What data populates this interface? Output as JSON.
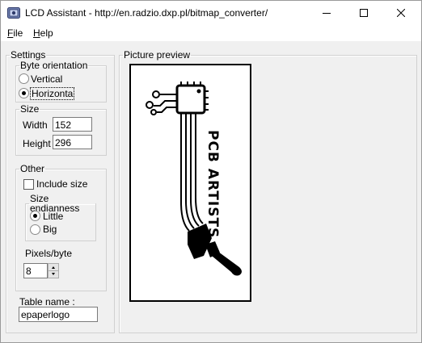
{
  "window": {
    "title": "LCD Assistant -  http://en.radzio.dxp.pl/bitmap_converter/",
    "icon": "lcd-assistant-app-icon",
    "controls": [
      "minimize-icon",
      "maximize-icon",
      "close-icon"
    ]
  },
  "menu": {
    "file_first": "F",
    "file_rest": "ile",
    "help_first": "H",
    "help_rest": "elp"
  },
  "settings": {
    "group_label": "Settings",
    "byte_orientation": {
      "label": "Byte orientation",
      "options": [
        "Vertical",
        "Horizonta"
      ],
      "selected": "Horizonta"
    },
    "size": {
      "label": "Size",
      "width_label": "Width",
      "width_value": "152",
      "height_label": "Height",
      "height_value": "296"
    },
    "other": {
      "label": "Other",
      "include_size_label": "Include size",
      "include_size_checked": false,
      "endianness": {
        "label": "Size endianness",
        "options": [
          "Little",
          "Big"
        ],
        "selected": "Little"
      },
      "pixels_per_byte_label": "Pixels/byte",
      "pixels_per_byte_value": "8"
    },
    "table_name_label": "Table name :",
    "table_name_value": "epaperlogo"
  },
  "preview": {
    "group_label": "Picture preview",
    "image_text": "PCB ARTISTS"
  },
  "colors": {
    "window_bg": "#f0f0f0",
    "titlebar_bg": "#ffffff",
    "preview_bg": "#ffffff",
    "ink": "#000000"
  }
}
